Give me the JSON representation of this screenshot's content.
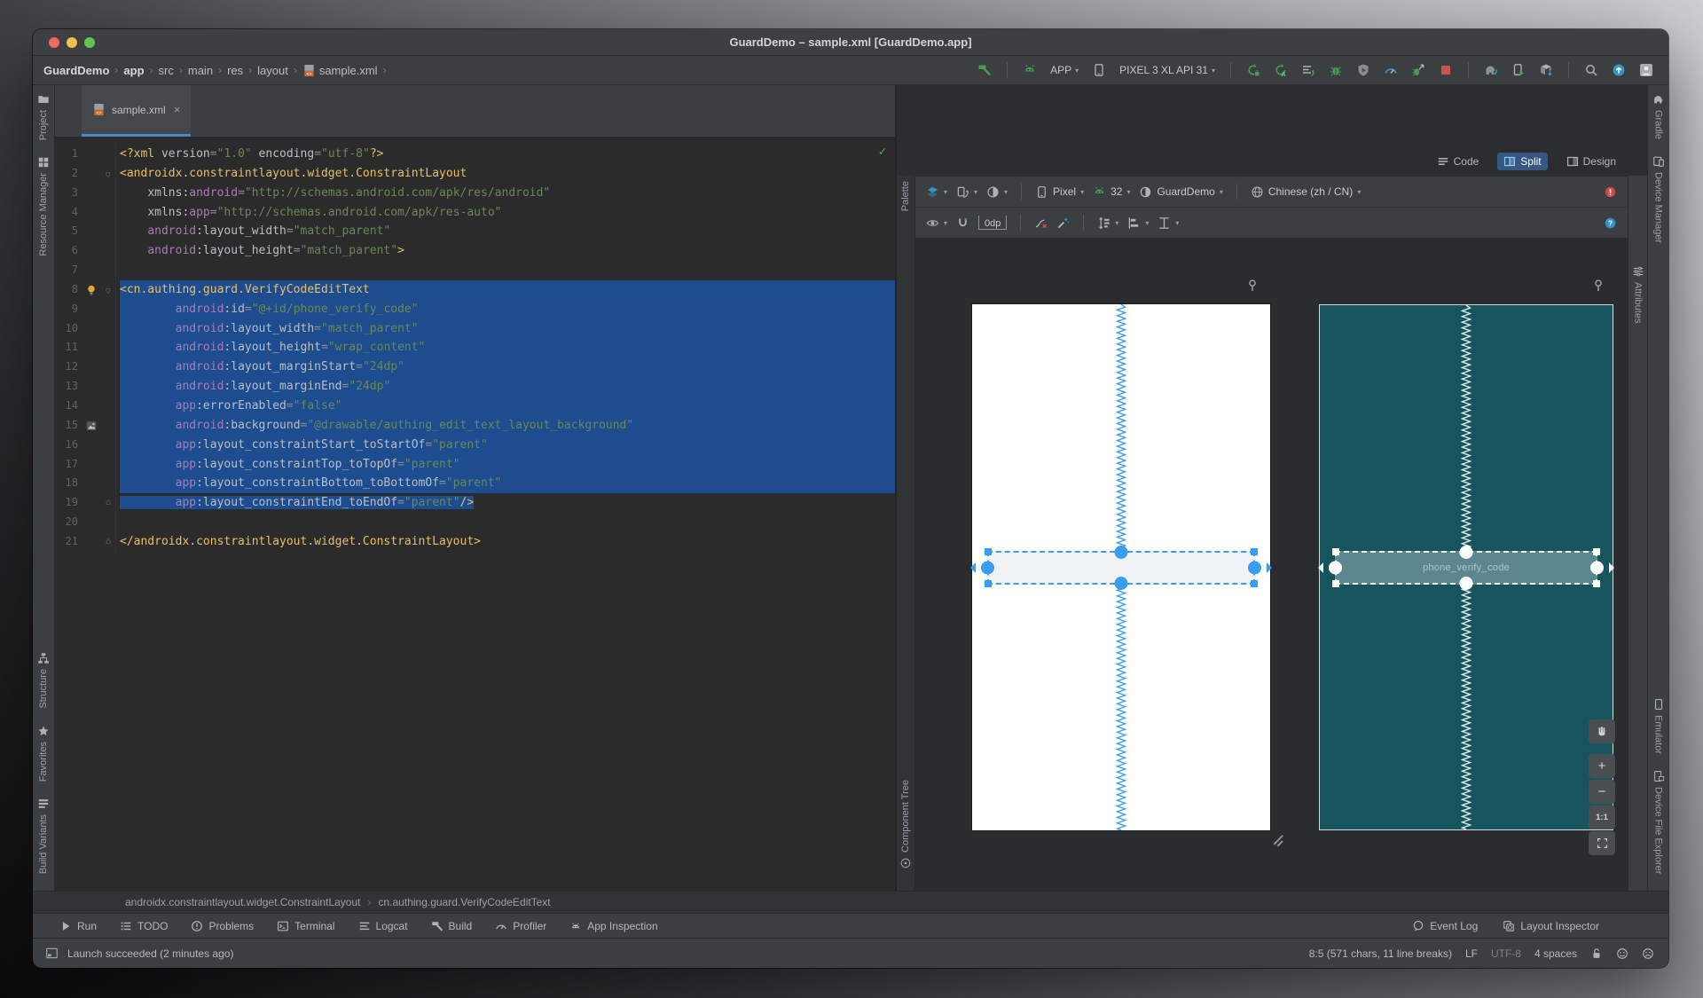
{
  "titlebar": {
    "title": "GuardDemo – sample.xml [GuardDemo.app]"
  },
  "toolbar": {
    "breadcrumbs": [
      {
        "label": "GuardDemo",
        "bold": true
      },
      {
        "label": "app",
        "bold": true
      },
      {
        "label": "src"
      },
      {
        "label": "main"
      },
      {
        "label": "res"
      },
      {
        "label": "layout"
      },
      {
        "label": "sample.xml",
        "icon": "xmlFile"
      }
    ],
    "groups": [
      {
        "items": [
          {
            "name": "build-project-button",
            "icon": "hammer"
          }
        ]
      },
      {
        "items": [
          {
            "name": "android-logo",
            "icon": "android"
          },
          {
            "name": "run-configuration-select",
            "label": "APP",
            "caret": true
          },
          {
            "name": "device-icon-button",
            "icon": "phone"
          },
          {
            "name": "target-device-select",
            "label": "PIXEL 3 XL API 31",
            "caret": true
          }
        ]
      },
      {
        "items": [
          {
            "name": "rerun-button",
            "icon": "rerun"
          },
          {
            "name": "apply-code-changes-button",
            "icon": "applyA"
          },
          {
            "name": "profile-lines-button",
            "icon": "profl"
          },
          {
            "name": "debug-button",
            "icon": "bug"
          },
          {
            "name": "run-coverage-button",
            "icon": "shieldPlay"
          },
          {
            "name": "profiler-button",
            "icon": "gauge"
          },
          {
            "name": "attach-debugger-button",
            "icon": "bugArrow"
          },
          {
            "name": "stop-button",
            "icon": "stop"
          }
        ]
      },
      {
        "items": [
          {
            "name": "sync-gradle-button",
            "icon": "gradleSync"
          },
          {
            "name": "device-manager-button",
            "icon": "deviceSync"
          },
          {
            "name": "sdk-manager-button",
            "icon": "sdk"
          }
        ]
      },
      {
        "items": [
          {
            "name": "search-everywhere-button",
            "icon": "search"
          },
          {
            "name": "ide-update-button",
            "icon": "upgrade"
          },
          {
            "name": "profile-avatar",
            "icon": "avatar"
          }
        ]
      }
    ]
  },
  "left_strip": {
    "top": [
      {
        "label": "Project",
        "icon": "folder",
        "name": "project"
      },
      {
        "label": "Resource Manager",
        "icon": "resMgr",
        "name": "resource-manager"
      }
    ],
    "bottom": [
      {
        "label": "Structure",
        "icon": "structure",
        "name": "structure"
      },
      {
        "label": "Favorites",
        "icon": "star",
        "name": "favorites"
      },
      {
        "label": "Build Variants",
        "icon": "variants",
        "name": "build-variants"
      }
    ]
  },
  "right_strip": {
    "top": [
      {
        "label": "Gradle",
        "icon": "gradle",
        "name": "gradle"
      },
      {
        "label": "Device Manager",
        "icon": "devMgr",
        "name": "device-manager"
      }
    ],
    "bottom": [
      {
        "label": "Emulator",
        "icon": "emulator",
        "name": "emulator"
      },
      {
        "label": "Device File Explorer",
        "icon": "dfe",
        "name": "device-file-explorer"
      }
    ]
  },
  "editor": {
    "tab": "sample.xml",
    "lines": [
      {
        "n": 1,
        "t": [
          [
            "g",
            "<?xml"
          ],
          [
            "a",
            " version"
          ],
          [
            "q",
            "="
          ],
          [
            "s",
            "\"1.0\""
          ],
          [
            "a",
            " encoding"
          ],
          [
            "q",
            "="
          ],
          [
            "s",
            "\"utf-8\""
          ],
          [
            "g",
            "?>"
          ]
        ]
      },
      {
        "n": 2,
        "fold": "down",
        "t": [
          [
            "g",
            "<androidx.constraintlayout.widget.ConstraintLayout"
          ]
        ]
      },
      {
        "n": 3,
        "t": [
          [
            "w",
            "    "
          ],
          [
            "a",
            "xmlns:"
          ],
          [
            "n",
            "android"
          ],
          [
            "q",
            "="
          ],
          [
            "s",
            "\"http://schemas.android.com/apk/res/android\""
          ]
        ]
      },
      {
        "n": 4,
        "t": [
          [
            "w",
            "    "
          ],
          [
            "a",
            "xmlns:"
          ],
          [
            "n",
            "app"
          ],
          [
            "q",
            "="
          ],
          [
            "s",
            "\"http://schemas.android.com/apk/res-auto\""
          ]
        ]
      },
      {
        "n": 5,
        "t": [
          [
            "w",
            "    "
          ],
          [
            "n",
            "android"
          ],
          [
            "a",
            ":layout_width"
          ],
          [
            "q",
            "="
          ],
          [
            "s",
            "\"match_parent\""
          ]
        ]
      },
      {
        "n": 6,
        "t": [
          [
            "w",
            "    "
          ],
          [
            "n",
            "android"
          ],
          [
            "a",
            ":layout_height"
          ],
          [
            "q",
            "="
          ],
          [
            "s",
            "\"match_parent\""
          ],
          [
            "g",
            ">"
          ]
        ]
      },
      {
        "n": 7,
        "t": []
      },
      {
        "n": 8,
        "sel": 1,
        "bulb": true,
        "fold": "down",
        "t": [
          [
            "g",
            "<cn.authing.guard.VerifyCodeEditText"
          ]
        ]
      },
      {
        "n": 9,
        "sel": 1,
        "t": [
          [
            "w",
            "        "
          ],
          [
            "n",
            "android"
          ],
          [
            "a",
            ":id"
          ],
          [
            "q",
            "="
          ],
          [
            "s",
            "\"@+id/phone_verify_code\""
          ]
        ]
      },
      {
        "n": 10,
        "sel": 1,
        "t": [
          [
            "w",
            "        "
          ],
          [
            "n",
            "android"
          ],
          [
            "a",
            ":layout_width"
          ],
          [
            "q",
            "="
          ],
          [
            "s",
            "\"match_parent\""
          ]
        ]
      },
      {
        "n": 11,
        "sel": 1,
        "t": [
          [
            "w",
            "        "
          ],
          [
            "n",
            "android"
          ],
          [
            "a",
            ":layout_height"
          ],
          [
            "q",
            "="
          ],
          [
            "s",
            "\"wrap_content\""
          ]
        ]
      },
      {
        "n": 12,
        "sel": 1,
        "t": [
          [
            "w",
            "        "
          ],
          [
            "n",
            "android"
          ],
          [
            "a",
            ":layout_marginStart"
          ],
          [
            "q",
            "="
          ],
          [
            "s",
            "\"24dp\""
          ]
        ]
      },
      {
        "n": 13,
        "sel": 1,
        "t": [
          [
            "w",
            "        "
          ],
          [
            "n",
            "android"
          ],
          [
            "a",
            ":layout_marginEnd"
          ],
          [
            "q",
            "="
          ],
          [
            "s",
            "\"24dp\""
          ]
        ]
      },
      {
        "n": 14,
        "sel": 1,
        "t": [
          [
            "w",
            "        "
          ],
          [
            "n",
            "app"
          ],
          [
            "a",
            ":errorEnabled"
          ],
          [
            "q",
            "="
          ],
          [
            "s",
            "\"false\""
          ]
        ]
      },
      {
        "n": 15,
        "sel": 1,
        "img": true,
        "t": [
          [
            "w",
            "        "
          ],
          [
            "n",
            "android"
          ],
          [
            "a",
            ":background"
          ],
          [
            "q",
            "="
          ],
          [
            "s",
            "\"@drawable/authing_edit_text_layout_background\""
          ]
        ]
      },
      {
        "n": 16,
        "sel": 1,
        "t": [
          [
            "w",
            "        "
          ],
          [
            "n",
            "app"
          ],
          [
            "a",
            ":layout_constraintStart_toStartOf"
          ],
          [
            "q",
            "="
          ],
          [
            "s",
            "\"parent\""
          ]
        ]
      },
      {
        "n": 17,
        "sel": 1,
        "t": [
          [
            "w",
            "        "
          ],
          [
            "n",
            "app"
          ],
          [
            "a",
            ":layout_constraintTop_toTopOf"
          ],
          [
            "q",
            "="
          ],
          [
            "s",
            "\"parent\""
          ]
        ]
      },
      {
        "n": 18,
        "sel": 1,
        "t": [
          [
            "w",
            "        "
          ],
          [
            "n",
            "app"
          ],
          [
            "a",
            ":layout_constraintBottom_toBottomOf"
          ],
          [
            "q",
            "="
          ],
          [
            "s",
            "\"parent\""
          ]
        ]
      },
      {
        "n": 19,
        "sel": 2,
        "fold": "up",
        "t": [
          [
            "w",
            "        "
          ],
          [
            "n",
            "app"
          ],
          [
            "a",
            ":layout_constraintEnd_toEndOf"
          ],
          [
            "q",
            "="
          ],
          [
            "s",
            "\"parent\""
          ],
          [
            "g",
            "/>"
          ]
        ]
      },
      {
        "n": 20,
        "t": []
      },
      {
        "n": 21,
        "fold": "up",
        "t": [
          [
            "g",
            "</androidx.constraintlayout.widget.ConstraintLayout>"
          ]
        ]
      }
    ]
  },
  "design": {
    "modes": [
      {
        "label": "Code",
        "icon": "codeView",
        "name": "code"
      },
      {
        "label": "Split",
        "icon": "splitView",
        "name": "split",
        "active": true
      },
      {
        "label": "Design",
        "icon": "designView",
        "name": "design"
      }
    ],
    "toolbar1": [
      {
        "type": "btn",
        "name": "design-surface-select",
        "icon": "layers",
        "caret": true
      },
      {
        "type": "btn",
        "name": "orientation-select",
        "icon": "orient",
        "caret": true
      },
      {
        "type": "btn",
        "name": "night-mode-select",
        "icon": "night",
        "caret": true
      },
      {
        "type": "div"
      },
      {
        "type": "select",
        "name": "device-select",
        "icon": "phone",
        "label": "Pixel"
      },
      {
        "type": "select",
        "name": "api-version-select",
        "icon": "android",
        "label": "32"
      },
      {
        "type": "select",
        "name": "theme-select",
        "icon": "themeC",
        "label": "GuardDemo"
      },
      {
        "type": "div"
      },
      {
        "type": "select",
        "name": "locale-select",
        "icon": "globe",
        "label": "Chinese (zh / CN)"
      },
      {
        "type": "spacer"
      },
      {
        "type": "btn",
        "name": "issue-panel-button",
        "icon": "errorBadge"
      }
    ],
    "toolbar2": [
      {
        "type": "btn",
        "name": "view-options-button",
        "icon": "eye",
        "caret": true
      },
      {
        "type": "btn",
        "name": "autoconnect-toggle",
        "icon": "magnet"
      },
      {
        "type": "margin",
        "name": "default-margin-select",
        "label": "0dp"
      },
      {
        "type": "div"
      },
      {
        "type": "btn",
        "name": "clear-constraints-button",
        "icon": "clearC"
      },
      {
        "type": "btn",
        "name": "infer-constraints-button",
        "icon": "wand"
      },
      {
        "type": "div"
      },
      {
        "type": "btn",
        "name": "pack-button",
        "icon": "pack",
        "caret": true
      },
      {
        "type": "btn",
        "name": "align-button",
        "icon": "alignB",
        "caret": true
      },
      {
        "type": "btn",
        "name": "distribute-button",
        "icon": "distr",
        "caret": true
      },
      {
        "type": "spacer"
      },
      {
        "type": "btn",
        "name": "help-button",
        "icon": "help"
      }
    ],
    "palette_label": "Palette",
    "component_tree_label": "Component Tree",
    "attributes_label": "Attributes",
    "widget_id": "phone_verify_code",
    "zoom_controls": {
      "zoom_label": "1:1"
    }
  },
  "xml_breadcrumb": [
    "androidx.constraintlayout.widget.ConstraintLayout",
    "cn.authing.guard.VerifyCodeEditText"
  ],
  "bottom_bar": {
    "left": [
      {
        "label": "Run",
        "icon": "play",
        "name": "run"
      },
      {
        "label": "TODO",
        "icon": "todo",
        "name": "todo"
      },
      {
        "label": "Problems",
        "icon": "problems",
        "name": "problems"
      },
      {
        "label": "Terminal",
        "icon": "terminal",
        "name": "terminal"
      },
      {
        "label": "Logcat",
        "icon": "logcat",
        "name": "logcat"
      },
      {
        "label": "Build",
        "icon": "hammerG",
        "name": "build"
      },
      {
        "label": "Profiler",
        "icon": "gaugeSm",
        "name": "profiler"
      },
      {
        "label": "App Inspection",
        "icon": "appInsp",
        "name": "app-inspection"
      }
    ],
    "right": [
      {
        "label": "Event Log",
        "icon": "balloon",
        "name": "event-log"
      },
      {
        "label": "Layout Inspector",
        "icon": "layoutInsp",
        "name": "layout-inspector"
      }
    ]
  },
  "status": {
    "message": "Launch succeeded (2 minutes ago)",
    "caret_position": "8:5 (571 chars, 11 line breaks)",
    "line_separator": "LF",
    "encoding": "UTF-8",
    "indent": "4 spaces"
  },
  "colors": {
    "accent_blue": "#3A9DF0",
    "selection_blue": "#1D4D8F",
    "blueprint_bg": "#17545E",
    "tag_gold": "#E8BF6A",
    "string_green": "#6A8759",
    "namespace_purple": "#AB7BB3",
    "run_green": "#499C54",
    "stop_red": "#C75450"
  }
}
